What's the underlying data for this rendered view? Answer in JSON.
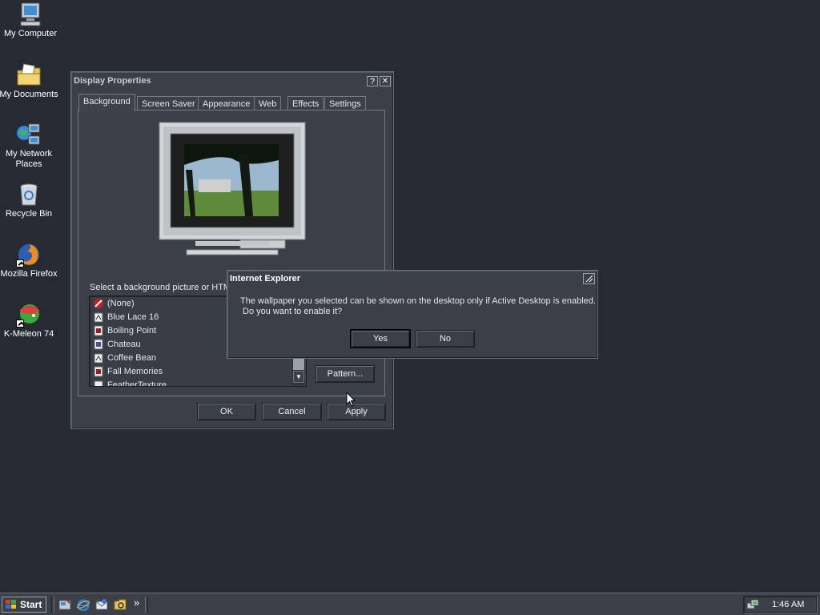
{
  "desktop": {
    "icons": [
      {
        "label": "My Computer"
      },
      {
        "label": "My Documents"
      },
      {
        "label": "My Network Places"
      },
      {
        "label": "Recycle Bin"
      },
      {
        "label": "Mozilla Firefox"
      },
      {
        "label": "K-Meleon 74"
      }
    ]
  },
  "display_properties": {
    "title": "Display Properties",
    "help_btn": "?",
    "close_btn": "✕",
    "tabs": [
      "Background",
      "Screen Saver",
      "Appearance",
      "Web",
      "Effects",
      "Settings"
    ],
    "select_label": "Select a background picture or HTM",
    "list_items": [
      "(None)",
      "Blue Lace 16",
      "Boiling Point",
      "Chateau",
      "Coffee Bean",
      "Fall Memories",
      "FeatherTexture"
    ],
    "pattern_btn": "Pattern...",
    "ok": "OK",
    "cancel": "Cancel",
    "apply": "Apply"
  },
  "ie_dialog": {
    "title": "Internet Explorer",
    "message_line1": "The wallpaper you selected can be shown on the desktop only if Active Desktop is enabled.",
    "message_line2": "Do you want to enable it?",
    "yes": "Yes",
    "no": "No"
  },
  "taskbar": {
    "start": "Start",
    "overflow": "»",
    "clock": "1:46 AM"
  },
  "colors": {
    "desktop": "#262b33",
    "window": "#3a3f48",
    "text": "#e6e6e6"
  }
}
